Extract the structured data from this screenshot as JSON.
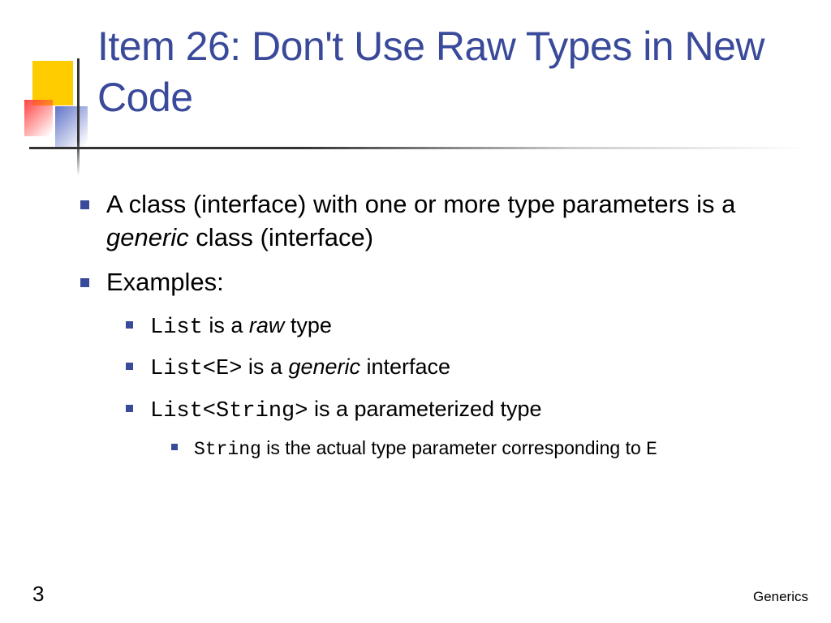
{
  "title": "Item 26: Don't Use Raw Types in New Code",
  "bullets": {
    "b1a_pre": "A class (interface) with one or more type parameters is a ",
    "b1a_em": "generic",
    "b1a_post": " class (interface)",
    "b1b": "Examples:",
    "b2a_code": "List",
    "b2a_mid": " is a ",
    "b2a_em": "raw",
    "b2a_post": " type",
    "b2b_code": "List<E>",
    "b2b_mid": " is a ",
    "b2b_em": "generic",
    "b2b_post": " interface",
    "b2c_code": "List<String>",
    "b2c_post": " is a parameterized type",
    "b3a_code": "String",
    "b3a_mid": " is the actual type parameter corresponding to ",
    "b3a_code2": "E"
  },
  "page_number": "3",
  "footer": "Generics"
}
